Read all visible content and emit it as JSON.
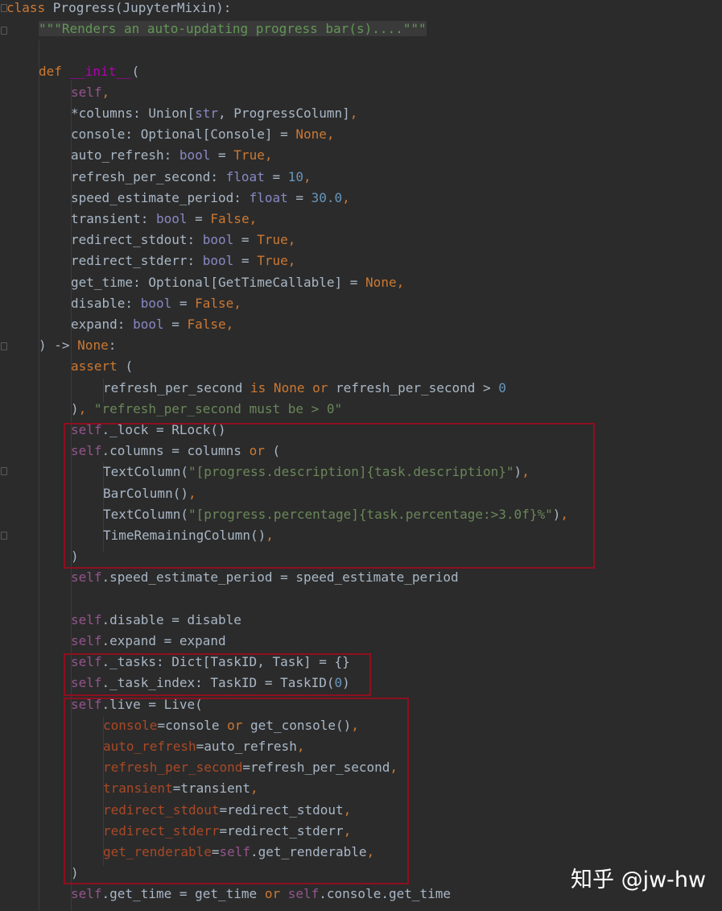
{
  "code_lines": [
    {
      "indent": 0,
      "tokens": [
        {
          "t": "class ",
          "k": "kw"
        },
        {
          "t": "Progress(JupyterMixin):",
          "k": "plain"
        }
      ]
    },
    {
      "indent": 1,
      "tokens": [
        {
          "t": "\"\"\"Renders an auto-updating progress bar(s)....\"\"\"",
          "k": "doc"
        }
      ]
    },
    {
      "indent": 0,
      "tokens": []
    },
    {
      "indent": 1,
      "tokens": [
        {
          "t": "def ",
          "k": "kw"
        },
        {
          "t": "__init__",
          "k": "dunder"
        },
        {
          "t": "(",
          "k": "plain"
        }
      ]
    },
    {
      "indent": 2,
      "tokens": [
        {
          "t": "self",
          "k": "self"
        },
        {
          "t": ",",
          "k": "kw"
        }
      ]
    },
    {
      "indent": 2,
      "tokens": [
        {
          "t": "*columns: Union[",
          "k": "plain"
        },
        {
          "t": "str",
          "k": "type"
        },
        {
          "t": ", ProgressColumn]",
          "k": "plain"
        },
        {
          "t": ",",
          "k": "kw"
        }
      ]
    },
    {
      "indent": 2,
      "tokens": [
        {
          "t": "console: Optional[Console] = ",
          "k": "plain"
        },
        {
          "t": "None,",
          "k": "kw"
        }
      ]
    },
    {
      "indent": 2,
      "tokens": [
        {
          "t": "auto_refresh: ",
          "k": "plain"
        },
        {
          "t": "bool",
          "k": "type"
        },
        {
          "t": " = ",
          "k": "plain"
        },
        {
          "t": "True,",
          "k": "kw"
        }
      ]
    },
    {
      "indent": 2,
      "tokens": [
        {
          "t": "refresh_per_second: ",
          "k": "plain"
        },
        {
          "t": "float",
          "k": "type"
        },
        {
          "t": " = ",
          "k": "plain"
        },
        {
          "t": "10",
          "k": "num"
        },
        {
          "t": ",",
          "k": "kw"
        }
      ]
    },
    {
      "indent": 2,
      "tokens": [
        {
          "t": "speed_estimate_period: ",
          "k": "plain"
        },
        {
          "t": "float",
          "k": "type"
        },
        {
          "t": " = ",
          "k": "plain"
        },
        {
          "t": "30.0",
          "k": "num"
        },
        {
          "t": ",",
          "k": "kw"
        }
      ]
    },
    {
      "indent": 2,
      "tokens": [
        {
          "t": "transient: ",
          "k": "plain"
        },
        {
          "t": "bool",
          "k": "type"
        },
        {
          "t": " = ",
          "k": "plain"
        },
        {
          "t": "False,",
          "k": "kw"
        }
      ]
    },
    {
      "indent": 2,
      "tokens": [
        {
          "t": "redirect_stdout: ",
          "k": "plain"
        },
        {
          "t": "bool",
          "k": "type"
        },
        {
          "t": " = ",
          "k": "plain"
        },
        {
          "t": "True,",
          "k": "kw"
        }
      ]
    },
    {
      "indent": 2,
      "tokens": [
        {
          "t": "redirect_stderr: ",
          "k": "plain"
        },
        {
          "t": "bool",
          "k": "type"
        },
        {
          "t": " = ",
          "k": "plain"
        },
        {
          "t": "True,",
          "k": "kw"
        }
      ]
    },
    {
      "indent": 2,
      "tokens": [
        {
          "t": "get_time: Optional[GetTimeCallable] = ",
          "k": "plain"
        },
        {
          "t": "None,",
          "k": "kw"
        }
      ]
    },
    {
      "indent": 2,
      "tokens": [
        {
          "t": "disable: ",
          "k": "plain"
        },
        {
          "t": "bool",
          "k": "type"
        },
        {
          "t": " = ",
          "k": "plain"
        },
        {
          "t": "False,",
          "k": "kw"
        }
      ]
    },
    {
      "indent": 2,
      "tokens": [
        {
          "t": "expand: ",
          "k": "plain"
        },
        {
          "t": "bool",
          "k": "type"
        },
        {
          "t": " = ",
          "k": "plain"
        },
        {
          "t": "False,",
          "k": "kw"
        }
      ]
    },
    {
      "indent": 1,
      "tokens": [
        {
          "t": ") -> ",
          "k": "plain"
        },
        {
          "t": "None",
          "k": "kw"
        },
        {
          "t": ":",
          "k": "plain"
        }
      ]
    },
    {
      "indent": 2,
      "tokens": [
        {
          "t": "assert ",
          "k": "kw"
        },
        {
          "t": "(",
          "k": "plain"
        }
      ]
    },
    {
      "indent": 3,
      "tokens": [
        {
          "t": "refresh_per_second ",
          "k": "plain"
        },
        {
          "t": "is None or ",
          "k": "kw"
        },
        {
          "t": "refresh_per_second > ",
          "k": "plain"
        },
        {
          "t": "0",
          "k": "num"
        }
      ]
    },
    {
      "indent": 2,
      "tokens": [
        {
          "t": ")",
          "k": "plain"
        },
        {
          "t": ", ",
          "k": "kw"
        },
        {
          "t": "\"refresh_per_second must be > 0\"",
          "k": "str"
        }
      ]
    },
    {
      "indent": 2,
      "tokens": [
        {
          "t": "self",
          "k": "self"
        },
        {
          "t": "._lock = RLock()",
          "k": "plain"
        }
      ]
    },
    {
      "indent": 2,
      "tokens": [
        {
          "t": "self",
          "k": "self"
        },
        {
          "t": ".columns = columns ",
          "k": "plain"
        },
        {
          "t": "or ",
          "k": "kw"
        },
        {
          "t": "(",
          "k": "plain"
        }
      ]
    },
    {
      "indent": 3,
      "tokens": [
        {
          "t": "TextColumn(",
          "k": "plain"
        },
        {
          "t": "\"[progress.description]{task.description}\"",
          "k": "str"
        },
        {
          "t": ")",
          "k": "plain"
        },
        {
          "t": ",",
          "k": "kw"
        }
      ]
    },
    {
      "indent": 3,
      "tokens": [
        {
          "t": "BarColumn()",
          "k": "plain"
        },
        {
          "t": ",",
          "k": "kw"
        }
      ]
    },
    {
      "indent": 3,
      "tokens": [
        {
          "t": "TextColumn(",
          "k": "plain"
        },
        {
          "t": "\"[progress.percentage]{task.percentage:>3.0f}%\"",
          "k": "str"
        },
        {
          "t": ")",
          "k": "plain"
        },
        {
          "t": ",",
          "k": "kw"
        }
      ]
    },
    {
      "indent": 3,
      "tokens": [
        {
          "t": "TimeRemainingColumn()",
          "k": "plain"
        },
        {
          "t": ",",
          "k": "kw"
        }
      ]
    },
    {
      "indent": 2,
      "tokens": [
        {
          "t": ")",
          "k": "plain"
        }
      ]
    },
    {
      "indent": 2,
      "tokens": [
        {
          "t": "self",
          "k": "self"
        },
        {
          "t": ".speed_estimate_period = speed_estimate_period",
          "k": "plain"
        }
      ]
    },
    {
      "indent": 0,
      "tokens": []
    },
    {
      "indent": 2,
      "tokens": [
        {
          "t": "self",
          "k": "self"
        },
        {
          "t": ".disable = disable",
          "k": "plain"
        }
      ]
    },
    {
      "indent": 2,
      "tokens": [
        {
          "t": "self",
          "k": "self"
        },
        {
          "t": ".expand = expand",
          "k": "plain"
        }
      ]
    },
    {
      "indent": 2,
      "tokens": [
        {
          "t": "self",
          "k": "self"
        },
        {
          "t": "._tasks: Dict[TaskID, Task] = {}",
          "k": "plain"
        }
      ]
    },
    {
      "indent": 2,
      "tokens": [
        {
          "t": "self",
          "k": "self"
        },
        {
          "t": "._task_index: TaskID = TaskID(",
          "k": "plain"
        },
        {
          "t": "0",
          "k": "num"
        },
        {
          "t": ")",
          "k": "plain"
        }
      ]
    },
    {
      "indent": 2,
      "tokens": [
        {
          "t": "self",
          "k": "self"
        },
        {
          "t": ".live = Live(",
          "k": "plain"
        }
      ]
    },
    {
      "indent": 3,
      "tokens": [
        {
          "t": "console",
          "k": "param"
        },
        {
          "t": "=console ",
          "k": "plain"
        },
        {
          "t": "or ",
          "k": "kw"
        },
        {
          "t": "get_console()",
          "k": "plain"
        },
        {
          "t": ",",
          "k": "kw"
        }
      ]
    },
    {
      "indent": 3,
      "tokens": [
        {
          "t": "auto_refresh",
          "k": "param"
        },
        {
          "t": "=auto_refresh",
          "k": "plain"
        },
        {
          "t": ",",
          "k": "kw"
        }
      ]
    },
    {
      "indent": 3,
      "tokens": [
        {
          "t": "refresh_per_second",
          "k": "param"
        },
        {
          "t": "=refresh_per_second",
          "k": "plain"
        },
        {
          "t": ",",
          "k": "kw"
        }
      ]
    },
    {
      "indent": 3,
      "tokens": [
        {
          "t": "transient",
          "k": "param"
        },
        {
          "t": "=transient",
          "k": "plain"
        },
        {
          "t": ",",
          "k": "kw"
        }
      ]
    },
    {
      "indent": 3,
      "tokens": [
        {
          "t": "redirect_stdout",
          "k": "param"
        },
        {
          "t": "=redirect_stdout",
          "k": "plain"
        },
        {
          "t": ",",
          "k": "kw"
        }
      ]
    },
    {
      "indent": 3,
      "tokens": [
        {
          "t": "redirect_stderr",
          "k": "param"
        },
        {
          "t": "=redirect_stderr",
          "k": "plain"
        },
        {
          "t": ",",
          "k": "kw"
        }
      ]
    },
    {
      "indent": 3,
      "tokens": [
        {
          "t": "get_renderable",
          "k": "param"
        },
        {
          "t": "=",
          "k": "plain"
        },
        {
          "t": "self",
          "k": "self"
        },
        {
          "t": ".get_renderable",
          "k": "plain"
        },
        {
          "t": ",",
          "k": "kw"
        }
      ]
    },
    {
      "indent": 2,
      "tokens": [
        {
          "t": ")",
          "k": "plain"
        }
      ]
    },
    {
      "indent": 2,
      "tokens": [
        {
          "t": "self",
          "k": "self"
        },
        {
          "t": ".get_time = get_time ",
          "k": "plain"
        },
        {
          "t": "or ",
          "k": "kw"
        },
        {
          "t": "self",
          "k": "self"
        },
        {
          "t": ".console.get_time",
          "k": "plain"
        }
      ]
    }
  ],
  "watermark": "知乎 @jw-hw"
}
